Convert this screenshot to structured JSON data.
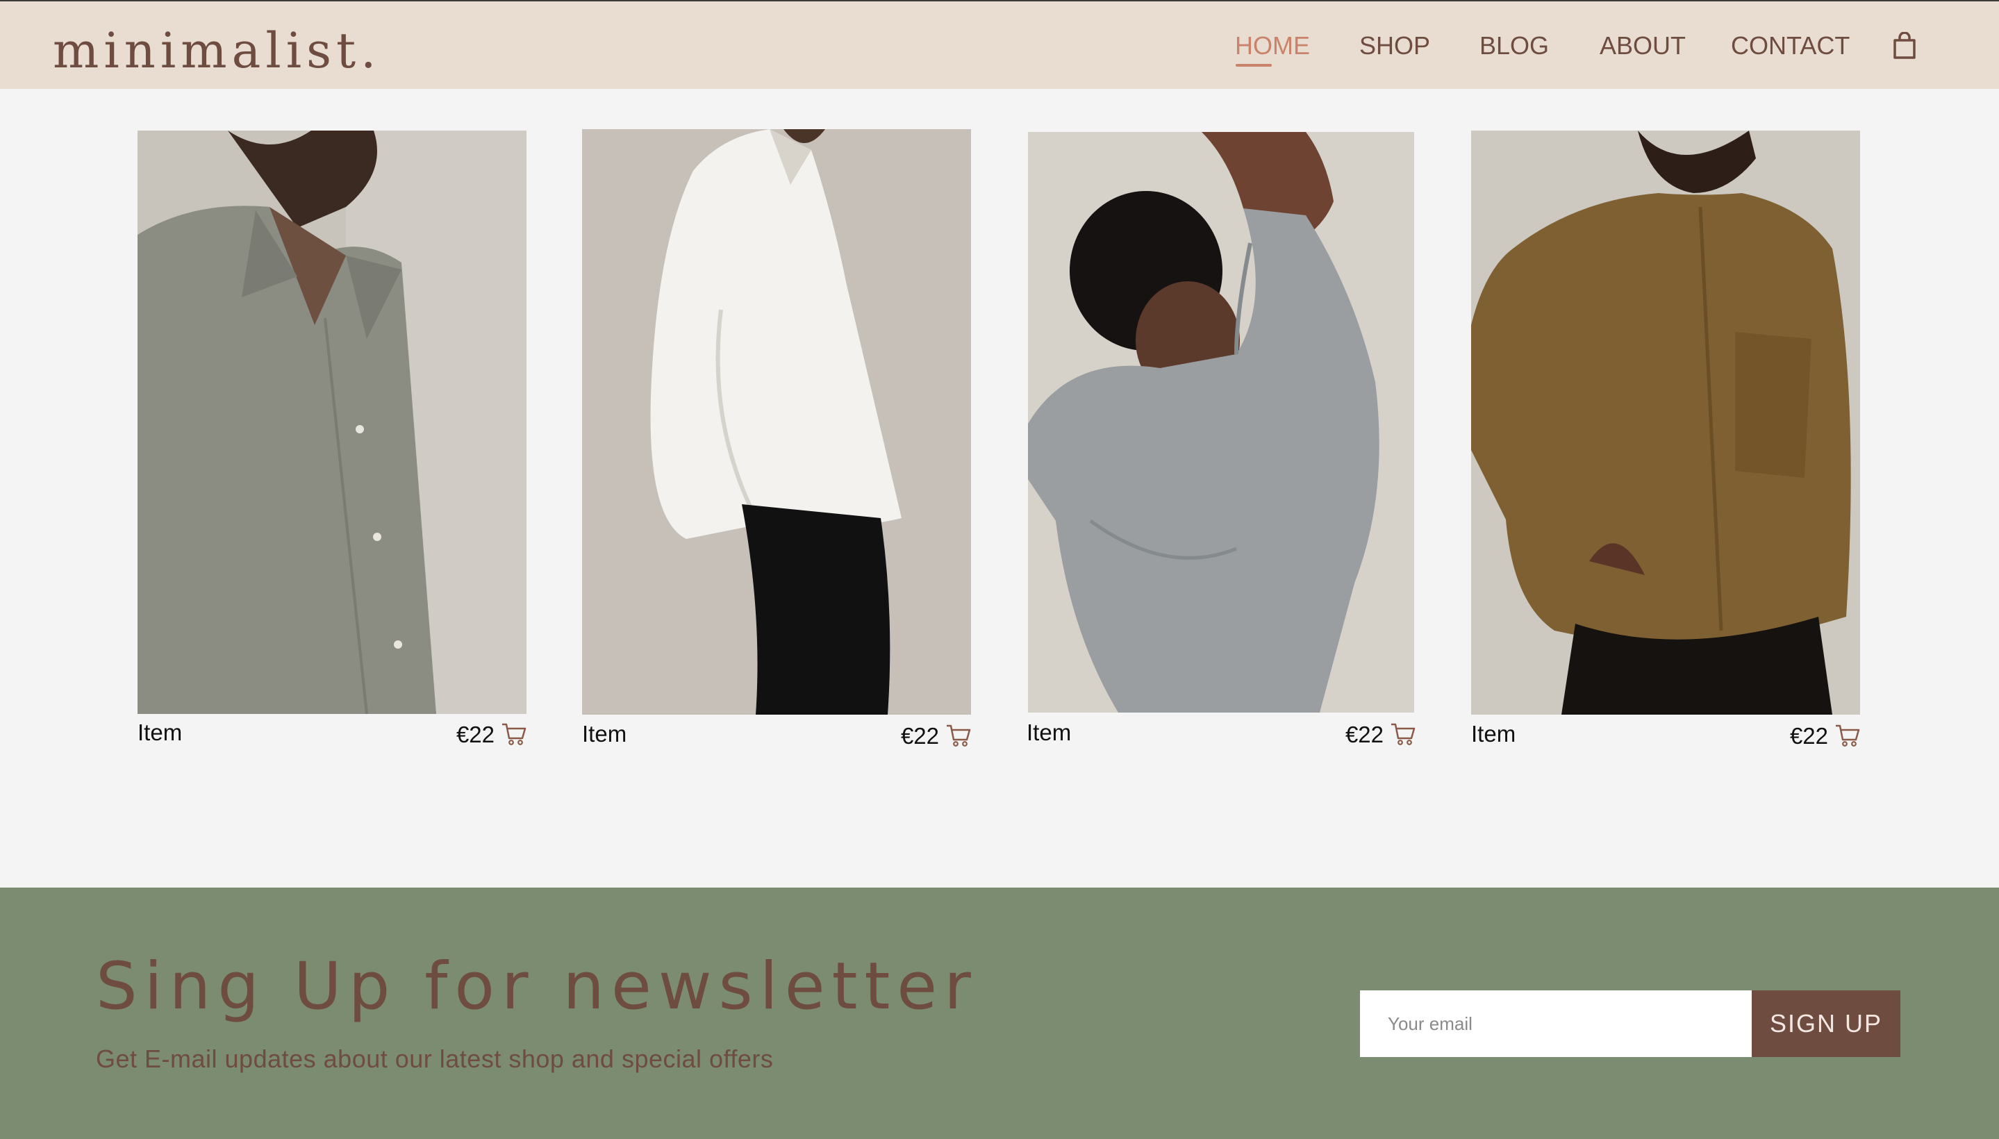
{
  "header": {
    "logo": "minimalist.",
    "nav": [
      "HOME",
      "SHOP",
      "BLOG",
      "ABOUT",
      "CONTACT"
    ],
    "active": "HOME",
    "icon": "shopping-bag-icon"
  },
  "products": [
    {
      "name": "Item",
      "price": "€22",
      "photo": "grey oversized shirt"
    },
    {
      "name": "Item",
      "price": "€22",
      "photo": "white shirt with black trousers"
    },
    {
      "name": "Item",
      "price": "€22",
      "photo": "grey sweatshirt"
    },
    {
      "name": "Item",
      "price": "€22",
      "photo": "brown cotton shirt"
    }
  ],
  "newsletter": {
    "title": "Sing Up for newsletter",
    "subtitle": "Get E-mail updates about our latest shop and special offers",
    "email_placeholder": "Your email",
    "button": "SIGN UP"
  },
  "colors": {
    "header_bg": "#e9ddd1",
    "brand_brown": "#6e4c40",
    "nav_active": "#c9836a",
    "page_bg": "#f4f4f4",
    "newsletter_bg": "#7b8c70"
  }
}
